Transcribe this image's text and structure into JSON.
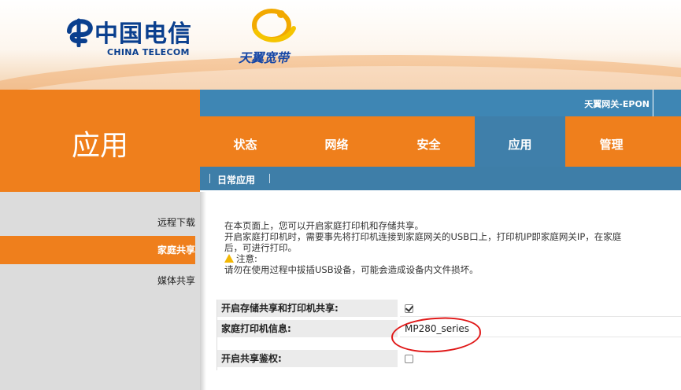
{
  "brand": {
    "telecom_cn": "中国电信",
    "telecom_en": "CHINA TELECOM",
    "tianyi": "天翼宽带"
  },
  "header": {
    "model": "天翼网关-EPON"
  },
  "section_title": "应用",
  "nav": {
    "items": [
      {
        "label": "状态"
      },
      {
        "label": "网络"
      },
      {
        "label": "安全"
      },
      {
        "label": "应用",
        "active": true
      },
      {
        "label": "管理"
      }
    ]
  },
  "subnav": {
    "label": "日常应用"
  },
  "sidebar": {
    "items": [
      {
        "label": "远程下载"
      },
      {
        "label": "家庭共享",
        "active": true
      },
      {
        "label": "媒体共享"
      }
    ]
  },
  "intro": {
    "line1": "在本页面上，您可以开启家庭打印机和存储共享。",
    "line2": "开启家庭打印机时，需要事先将打印机连接到家庭网关的USB口上，打印机IP即家庭网关IP，在家庭",
    "line3": "后，可进行打印。",
    "notice_label": "注意:",
    "notice_text": "请勿在使用过程中拔插USB设备，可能会造成设备内文件损坏。"
  },
  "settings": {
    "share_label": "开启存储共享和打印机共享:",
    "share_checked": true,
    "printer_label": "家庭打印机信息:",
    "printer_value": "MP280_series",
    "auth_label": "开启共享鉴权:",
    "auth_checked": false
  },
  "colors": {
    "orange": "#ef7f1c",
    "blue": "#3e86b4",
    "annotation_red": "#e01818"
  }
}
